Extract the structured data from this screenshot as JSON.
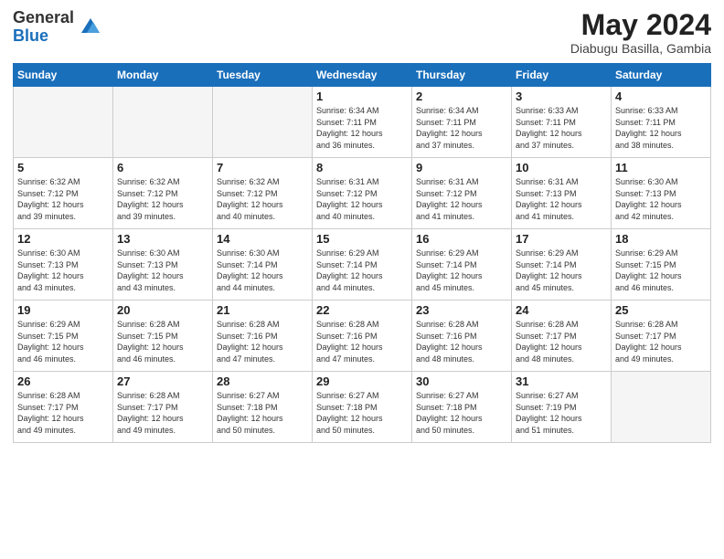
{
  "logo": {
    "general": "General",
    "blue": "Blue"
  },
  "header": {
    "month_year": "May 2024",
    "location": "Diabugu Basilla, Gambia"
  },
  "weekdays": [
    "Sunday",
    "Monday",
    "Tuesday",
    "Wednesday",
    "Thursday",
    "Friday",
    "Saturday"
  ],
  "weeks": [
    [
      {
        "day": "",
        "info": ""
      },
      {
        "day": "",
        "info": ""
      },
      {
        "day": "",
        "info": ""
      },
      {
        "day": "1",
        "info": "Sunrise: 6:34 AM\nSunset: 7:11 PM\nDaylight: 12 hours\nand 36 minutes."
      },
      {
        "day": "2",
        "info": "Sunrise: 6:34 AM\nSunset: 7:11 PM\nDaylight: 12 hours\nand 37 minutes."
      },
      {
        "day": "3",
        "info": "Sunrise: 6:33 AM\nSunset: 7:11 PM\nDaylight: 12 hours\nand 37 minutes."
      },
      {
        "day": "4",
        "info": "Sunrise: 6:33 AM\nSunset: 7:11 PM\nDaylight: 12 hours\nand 38 minutes."
      }
    ],
    [
      {
        "day": "5",
        "info": "Sunrise: 6:32 AM\nSunset: 7:12 PM\nDaylight: 12 hours\nand 39 minutes."
      },
      {
        "day": "6",
        "info": "Sunrise: 6:32 AM\nSunset: 7:12 PM\nDaylight: 12 hours\nand 39 minutes."
      },
      {
        "day": "7",
        "info": "Sunrise: 6:32 AM\nSunset: 7:12 PM\nDaylight: 12 hours\nand 40 minutes."
      },
      {
        "day": "8",
        "info": "Sunrise: 6:31 AM\nSunset: 7:12 PM\nDaylight: 12 hours\nand 40 minutes."
      },
      {
        "day": "9",
        "info": "Sunrise: 6:31 AM\nSunset: 7:12 PM\nDaylight: 12 hours\nand 41 minutes."
      },
      {
        "day": "10",
        "info": "Sunrise: 6:31 AM\nSunset: 7:13 PM\nDaylight: 12 hours\nand 41 minutes."
      },
      {
        "day": "11",
        "info": "Sunrise: 6:30 AM\nSunset: 7:13 PM\nDaylight: 12 hours\nand 42 minutes."
      }
    ],
    [
      {
        "day": "12",
        "info": "Sunrise: 6:30 AM\nSunset: 7:13 PM\nDaylight: 12 hours\nand 43 minutes."
      },
      {
        "day": "13",
        "info": "Sunrise: 6:30 AM\nSunset: 7:13 PM\nDaylight: 12 hours\nand 43 minutes."
      },
      {
        "day": "14",
        "info": "Sunrise: 6:30 AM\nSunset: 7:14 PM\nDaylight: 12 hours\nand 44 minutes."
      },
      {
        "day": "15",
        "info": "Sunrise: 6:29 AM\nSunset: 7:14 PM\nDaylight: 12 hours\nand 44 minutes."
      },
      {
        "day": "16",
        "info": "Sunrise: 6:29 AM\nSunset: 7:14 PM\nDaylight: 12 hours\nand 45 minutes."
      },
      {
        "day": "17",
        "info": "Sunrise: 6:29 AM\nSunset: 7:14 PM\nDaylight: 12 hours\nand 45 minutes."
      },
      {
        "day": "18",
        "info": "Sunrise: 6:29 AM\nSunset: 7:15 PM\nDaylight: 12 hours\nand 46 minutes."
      }
    ],
    [
      {
        "day": "19",
        "info": "Sunrise: 6:29 AM\nSunset: 7:15 PM\nDaylight: 12 hours\nand 46 minutes."
      },
      {
        "day": "20",
        "info": "Sunrise: 6:28 AM\nSunset: 7:15 PM\nDaylight: 12 hours\nand 46 minutes."
      },
      {
        "day": "21",
        "info": "Sunrise: 6:28 AM\nSunset: 7:16 PM\nDaylight: 12 hours\nand 47 minutes."
      },
      {
        "day": "22",
        "info": "Sunrise: 6:28 AM\nSunset: 7:16 PM\nDaylight: 12 hours\nand 47 minutes."
      },
      {
        "day": "23",
        "info": "Sunrise: 6:28 AM\nSunset: 7:16 PM\nDaylight: 12 hours\nand 48 minutes."
      },
      {
        "day": "24",
        "info": "Sunrise: 6:28 AM\nSunset: 7:17 PM\nDaylight: 12 hours\nand 48 minutes."
      },
      {
        "day": "25",
        "info": "Sunrise: 6:28 AM\nSunset: 7:17 PM\nDaylight: 12 hours\nand 49 minutes."
      }
    ],
    [
      {
        "day": "26",
        "info": "Sunrise: 6:28 AM\nSunset: 7:17 PM\nDaylight: 12 hours\nand 49 minutes."
      },
      {
        "day": "27",
        "info": "Sunrise: 6:28 AM\nSunset: 7:17 PM\nDaylight: 12 hours\nand 49 minutes."
      },
      {
        "day": "28",
        "info": "Sunrise: 6:27 AM\nSunset: 7:18 PM\nDaylight: 12 hours\nand 50 minutes."
      },
      {
        "day": "29",
        "info": "Sunrise: 6:27 AM\nSunset: 7:18 PM\nDaylight: 12 hours\nand 50 minutes."
      },
      {
        "day": "30",
        "info": "Sunrise: 6:27 AM\nSunset: 7:18 PM\nDaylight: 12 hours\nand 50 minutes."
      },
      {
        "day": "31",
        "info": "Sunrise: 6:27 AM\nSunset: 7:19 PM\nDaylight: 12 hours\nand 51 minutes."
      },
      {
        "day": "",
        "info": ""
      }
    ]
  ]
}
